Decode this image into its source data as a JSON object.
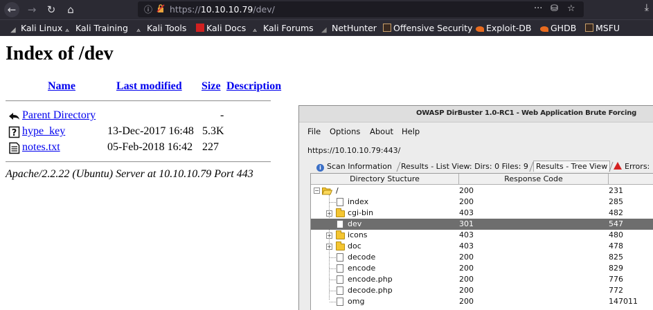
{
  "browser": {
    "url_prefix": "https://",
    "url_host": "10.10.10.79",
    "url_path": "/dev/",
    "page_actions": "···",
    "bookmarks": [
      {
        "label": "Kali Linux",
        "icon": "kali-dragon-icon"
      },
      {
        "label": "Kali Training",
        "icon": "kali-dragon-icon"
      },
      {
        "label": "Kali Tools",
        "icon": "kali-dragon-icon"
      },
      {
        "label": "Kali Docs",
        "icon": "kali-docs-icon"
      },
      {
        "label": "Kali Forums",
        "icon": "kali-dragon-icon"
      },
      {
        "label": "NetHunter",
        "icon": "nethunter-icon"
      },
      {
        "label": "Offensive Security",
        "icon": "offsec-icon"
      },
      {
        "label": "Exploit-DB",
        "icon": "exploitdb-icon"
      },
      {
        "label": "GHDB",
        "icon": "ghdb-icon"
      },
      {
        "label": "MSFU",
        "icon": "offsec-icon"
      }
    ]
  },
  "index": {
    "title": "Index of /dev",
    "headers": {
      "name": "Name",
      "modified": "Last modified",
      "size": "Size",
      "description": "Description"
    },
    "entries": [
      {
        "name": "Parent Directory",
        "modified": "",
        "size": "-",
        "icon": "back-arrow-icon"
      },
      {
        "name": "hype_key",
        "modified": "13-Dec-2017 16:48",
        "size": "5.3K",
        "icon": "unknown-file-icon"
      },
      {
        "name": "notes.txt",
        "modified": "05-Feb-2018 16:42",
        "size": "227",
        "icon": "text-file-icon"
      }
    ],
    "address": "Apache/2.2.22 (Ubuntu) Server at 10.10.10.79 Port 443"
  },
  "dirbuster": {
    "title": "OWASP DirBuster 1.0-RC1 - Web Application Brute Forcing",
    "menu": [
      "File",
      "Options",
      "About",
      "Help"
    ],
    "target": "https://10.10.10.79:443/",
    "tabs": [
      "Scan Information",
      "Results - List View: Dirs: 0 Files: 9",
      "Results - Tree View",
      "Errors:"
    ],
    "columns": [
      "Directory Stucture",
      "Response Code"
    ],
    "rows": [
      {
        "name": "/",
        "code": "200",
        "size": "231",
        "kind": "folder-open",
        "selected": false
      },
      {
        "name": "index",
        "code": "200",
        "size": "285",
        "kind": "file",
        "selected": false
      },
      {
        "name": "cgi-bin",
        "code": "403",
        "size": "482",
        "kind": "folder",
        "selected": false
      },
      {
        "name": "dev",
        "code": "301",
        "size": "547",
        "kind": "file",
        "selected": true
      },
      {
        "name": "icons",
        "code": "403",
        "size": "480",
        "kind": "folder",
        "selected": false
      },
      {
        "name": "doc",
        "code": "403",
        "size": "478",
        "kind": "folder",
        "selected": false
      },
      {
        "name": "decode",
        "code": "200",
        "size": "825",
        "kind": "file",
        "selected": false
      },
      {
        "name": "encode",
        "code": "200",
        "size": "829",
        "kind": "file",
        "selected": false
      },
      {
        "name": "encode.php",
        "code": "200",
        "size": "776",
        "kind": "file",
        "selected": false
      },
      {
        "name": "decode.php",
        "code": "200",
        "size": "772",
        "kind": "file",
        "selected": false
      },
      {
        "name": "omg",
        "code": "200",
        "size": "147011",
        "kind": "file",
        "selected": false
      }
    ]
  }
}
